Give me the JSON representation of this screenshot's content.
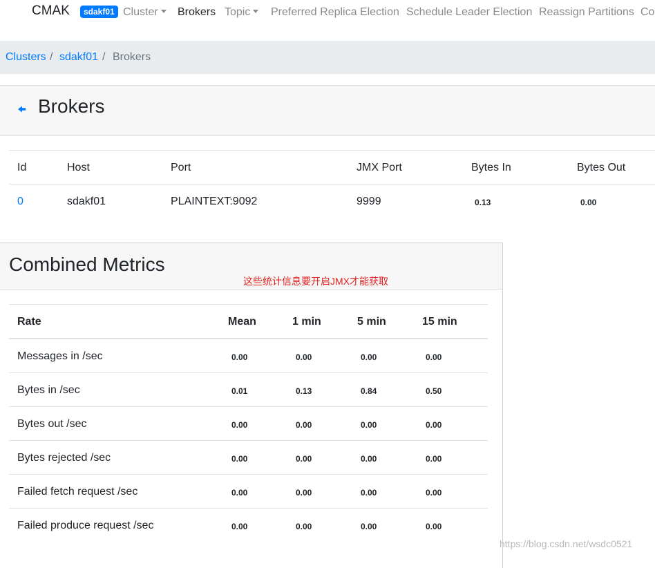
{
  "navbar": {
    "brand": "CMAK",
    "cluster_badge": "sdakf01",
    "items": [
      "Cluster",
      "Brokers",
      "Topic",
      "Preferred Replica Election",
      "Schedule Leader Election",
      "Reassign Partitions",
      "Co"
    ]
  },
  "breadcrumb": {
    "clusters": "Clusters",
    "cluster": "sdakf01",
    "current": "Brokers",
    "separator": "/"
  },
  "page": {
    "title": "Brokers",
    "back_icon": "arrow-left-icon"
  },
  "brokers_table": {
    "headers": [
      "Id",
      "Host",
      "Port",
      "JMX Port",
      "Bytes In",
      "Bytes Out"
    ],
    "rows": [
      [
        "0",
        "sdakf01",
        "PLAINTEXT:9092",
        "9999",
        "0.13",
        "0.00"
      ]
    ]
  },
  "metrics": {
    "title": "Combined Metrics",
    "annotation": "这些统计信息要开启JMX才能获取",
    "headers": [
      "Rate",
      "Mean",
      "1 min",
      "5 min",
      "15 min"
    ],
    "rows": [
      [
        "Messages in /sec",
        "0.00",
        "0.00",
        "0.00",
        "0.00"
      ],
      [
        "Bytes in /sec",
        "0.01",
        "0.13",
        "0.84",
        "0.50"
      ],
      [
        "Bytes out /sec",
        "0.00",
        "0.00",
        "0.00",
        "0.00"
      ],
      [
        "Bytes rejected /sec",
        "0.00",
        "0.00",
        "0.00",
        "0.00"
      ],
      [
        "Failed fetch request /sec",
        "0.00",
        "0.00",
        "0.00",
        "0.00"
      ],
      [
        "Failed produce request /sec",
        "0.00",
        "0.00",
        "0.00",
        "0.00"
      ]
    ]
  },
  "watermark": "https://blog.csdn.net/wsdc0521",
  "colors": {
    "link": "#007bff",
    "annotation": "#e02020",
    "badge": "#007bff"
  }
}
